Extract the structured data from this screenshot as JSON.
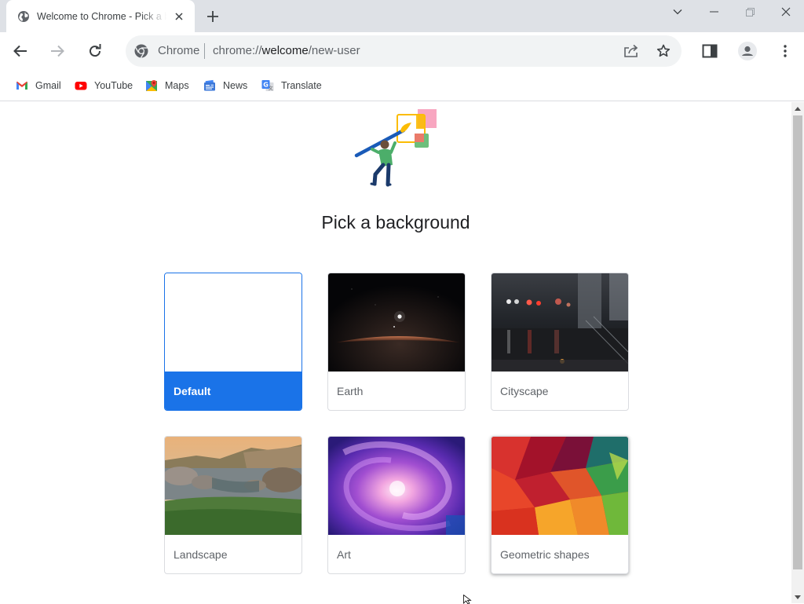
{
  "tab": {
    "title": "Welcome to Chrome - Pick a background",
    "favicon": "globe-icon"
  },
  "toolbar": {
    "site_chip": "Chrome",
    "url_scheme": "chrome://",
    "url_host": "welcome",
    "url_path": "/new-user"
  },
  "bookmarks": [
    {
      "label": "Gmail",
      "icon": "gmail-icon"
    },
    {
      "label": "YouTube",
      "icon": "youtube-icon"
    },
    {
      "label": "Maps",
      "icon": "maps-icon"
    },
    {
      "label": "News",
      "icon": "news-icon"
    },
    {
      "label": "Translate",
      "icon": "translate-icon"
    }
  ],
  "page": {
    "heading": "Pick a background",
    "backgrounds": [
      {
        "label": "Default",
        "selected": true
      },
      {
        "label": "Earth",
        "selected": false
      },
      {
        "label": "Cityscape",
        "selected": false
      },
      {
        "label": "Landscape",
        "selected": false
      },
      {
        "label": "Art",
        "selected": false
      },
      {
        "label": "Geometric shapes",
        "selected": false
      }
    ]
  },
  "colors": {
    "accent": "#1a73e8",
    "tabstrip": "#dee1e6",
    "omnibox": "#f1f3f4"
  }
}
